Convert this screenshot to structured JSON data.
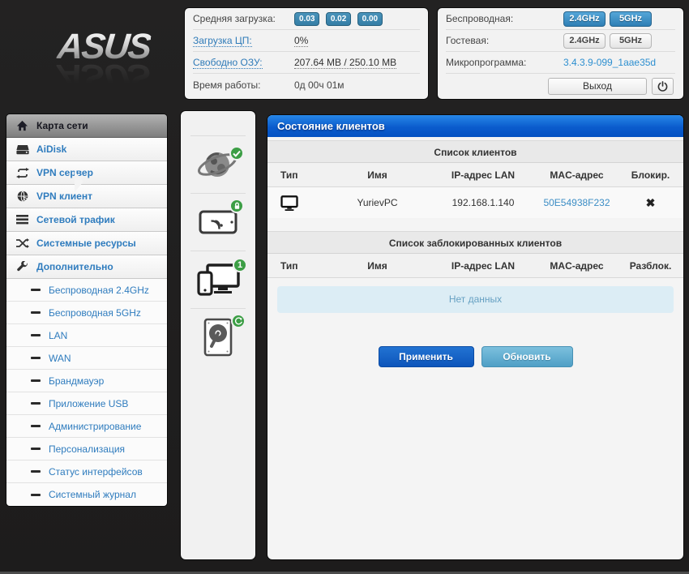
{
  "brand": {
    "logo_text": "ASUS"
  },
  "colors": {
    "accent_blue": "#0b5ccd",
    "badge_green": "#3c9e45",
    "link_blue": "#2f7cbe",
    "badge_teal": "#357ea6"
  },
  "stats": {
    "avg_load_label": "Средняя загрузка:",
    "badges": [
      "0.03",
      "0.02",
      "0.00"
    ],
    "cpu_label": "Загрузка ЦП:",
    "cpu_value": "0%",
    "ram_label": "Свободно ОЗУ:",
    "ram_value": "207.64 MB / 250.10 MB",
    "uptime_label": "Время работы:",
    "uptime_value": "0д 00ч 01м"
  },
  "wifi": {
    "wireless_label": "Беспроводная:",
    "guest_label": "Гостевая:",
    "firmware_label": "Микропрограмма:",
    "firmware_value": "3.4.3.9-099_1aae35d",
    "band_24": "2.4GHz",
    "band_5": "5GHz",
    "logout_label": "Выход"
  },
  "sidebar": {
    "items": [
      {
        "label": "Карта сети"
      },
      {
        "label": "AiDisk"
      },
      {
        "label": "VPN сервер"
      },
      {
        "label": "VPN клиент"
      },
      {
        "label": "Сетевой трафик"
      },
      {
        "label": "Системные ресурсы"
      },
      {
        "label": "Дополнительно"
      }
    ],
    "subitems": [
      {
        "label": "Беспроводная 2.4GHz"
      },
      {
        "label": "Беспроводная 5GHz"
      },
      {
        "label": "LAN"
      },
      {
        "label": "WAN"
      },
      {
        "label": "Брандмауэр"
      },
      {
        "label": "Приложение USB"
      },
      {
        "label": "Администрирование"
      },
      {
        "label": "Персонализация"
      },
      {
        "label": "Статус интерфейсов"
      },
      {
        "label": "Системный журнал"
      }
    ]
  },
  "network_map": {
    "internet_badge": "✔",
    "clients_count": "1"
  },
  "main": {
    "title": "Состояние клиентов",
    "clients": {
      "heading": "Список клиентов",
      "columns": [
        "Тип",
        "Имя",
        "IP-адрес LAN",
        "MAC-адрес",
        "Блокир."
      ],
      "rows": [
        {
          "name": "YurievPC",
          "ip": "192.168.1.140",
          "mac": "50E54938F232",
          "block_glyph": "✖"
        }
      ]
    },
    "blocked": {
      "heading": "Список заблокированных клиентов",
      "columns": [
        "Тип",
        "Имя",
        "IP-адрес LAN",
        "MAC-адрес",
        "Разблок."
      ],
      "empty": "Нет данных"
    },
    "apply_label": "Применить",
    "refresh_label": "Обновить"
  }
}
